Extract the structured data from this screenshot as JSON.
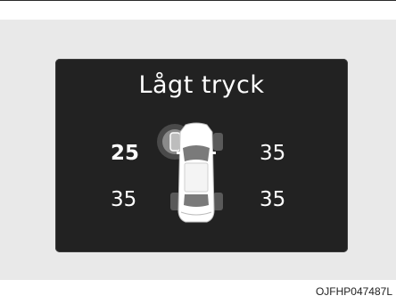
{
  "display": {
    "title": "Lågt tryck",
    "tires": {
      "front_left": "25",
      "front_right": "35",
      "rear_left": "35",
      "rear_right": "35"
    },
    "warning_tire": "front-left"
  },
  "colors": {
    "screen_background": "#222222",
    "text": "#ffffff",
    "warning_highlight": "#7a7a7a",
    "page_background": "#e9e9e9"
  },
  "icons": {
    "vehicle": "car-top-view-icon",
    "warning": "tire-warning-halo-icon"
  },
  "figure_code": "OJFHP047487L"
}
